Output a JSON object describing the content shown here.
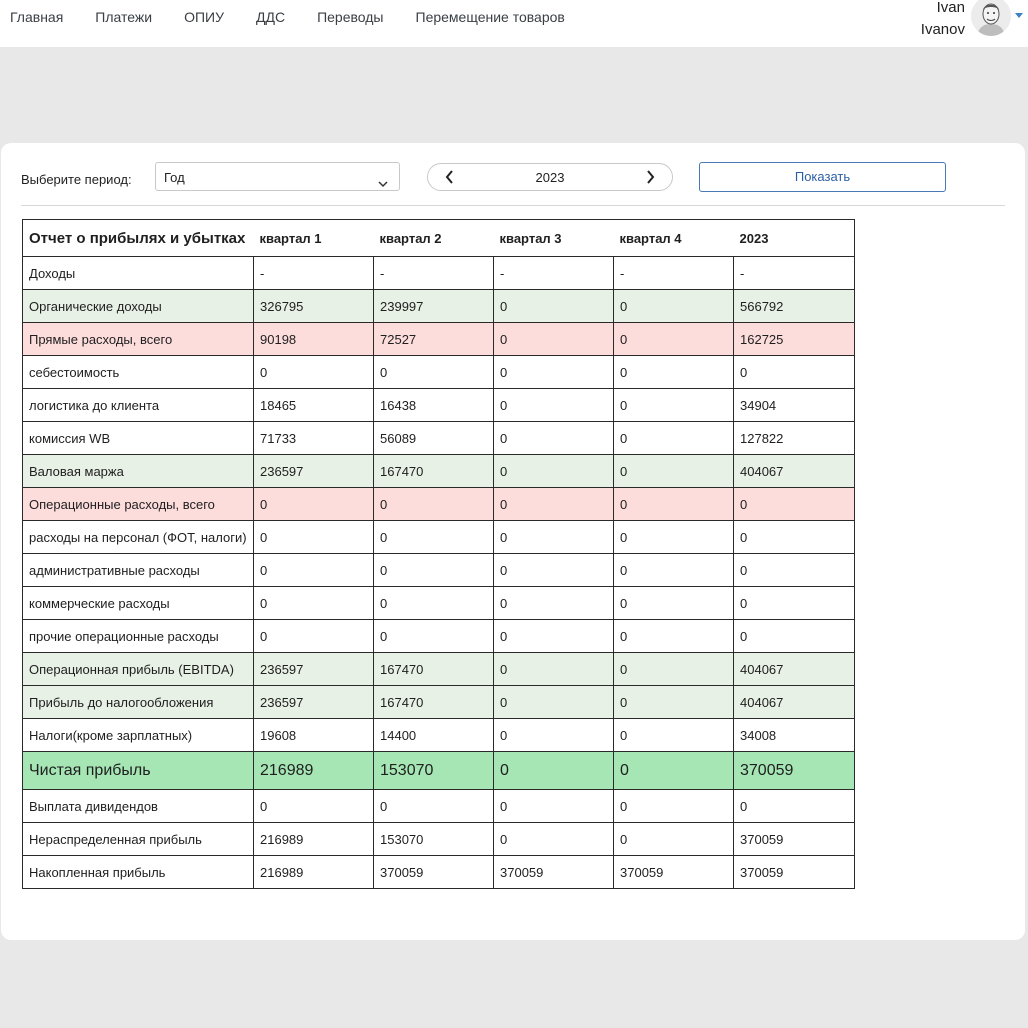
{
  "nav": {
    "items": [
      "Главная",
      "Платежи",
      "ОПИУ",
      "ДДС",
      "Переводы",
      "Перемещение товаров"
    ]
  },
  "user": {
    "first_name": "Ivan",
    "last_name": "Ivanov"
  },
  "filters": {
    "period_label": "Выберите период:",
    "period_value": "Год",
    "year": "2023",
    "show_button": "Показать"
  },
  "report": {
    "title": "Отчет о прибылях и убытках",
    "columns": [
      "квартал 1",
      "квартал 2",
      "квартал 3",
      "квартал 4",
      "2023"
    ],
    "rows": [
      {
        "label": "Доходы",
        "values": [
          "-",
          "-",
          "-",
          "-",
          "-"
        ],
        "style": "plain"
      },
      {
        "label": "Органические доходы",
        "values": [
          "326795",
          "239997",
          "0",
          "0",
          "566792"
        ],
        "style": "green"
      },
      {
        "label": "Прямые расходы, всего",
        "values": [
          "90198",
          "72527",
          "0",
          "0",
          "162725"
        ],
        "style": "red"
      },
      {
        "label": "себестоимость",
        "values": [
          "0",
          "0",
          "0",
          "0",
          "0"
        ],
        "style": "plain"
      },
      {
        "label": "логистика до клиента",
        "values": [
          "18465",
          "16438",
          "0",
          "0",
          "34904"
        ],
        "style": "plain"
      },
      {
        "label": "комиссия WB",
        "values": [
          "71733",
          "56089",
          "0",
          "0",
          "127822"
        ],
        "style": "plain"
      },
      {
        "label": "Валовая маржа",
        "values": [
          "236597",
          "167470",
          "0",
          "0",
          "404067"
        ],
        "style": "green"
      },
      {
        "label": "Операционные расходы, всего",
        "values": [
          "0",
          "0",
          "0",
          "0",
          "0"
        ],
        "style": "red"
      },
      {
        "label": "расходы на персонал (ФОТ, налоги)",
        "values": [
          "0",
          "0",
          "0",
          "0",
          "0"
        ],
        "style": "plain"
      },
      {
        "label": "административные расходы",
        "values": [
          "0",
          "0",
          "0",
          "0",
          "0"
        ],
        "style": "plain"
      },
      {
        "label": "коммерческие расходы",
        "values": [
          "0",
          "0",
          "0",
          "0",
          "0"
        ],
        "style": "plain"
      },
      {
        "label": "прочие операционные расходы",
        "values": [
          "0",
          "0",
          "0",
          "0",
          "0"
        ],
        "style": "plain"
      },
      {
        "label": "Операционная прибыль (EBITDA)",
        "values": [
          "236597",
          "167470",
          "0",
          "0",
          "404067"
        ],
        "style": "green"
      },
      {
        "label": "Прибыль до налогообложения",
        "values": [
          "236597",
          "167470",
          "0",
          "0",
          "404067"
        ],
        "style": "green"
      },
      {
        "label": "Налоги(кроме зарплатных)",
        "values": [
          "19608",
          "14400",
          "0",
          "0",
          "34008"
        ],
        "style": "plain"
      },
      {
        "label": "Чистая прибыль",
        "values": [
          "216989",
          "153070",
          "0",
          "0",
          "370059"
        ],
        "style": "net"
      },
      {
        "label": "Выплата дивидендов",
        "values": [
          "0",
          "0",
          "0",
          "0",
          "0"
        ],
        "style": "plain"
      },
      {
        "label": "Нераспределенная прибыль",
        "values": [
          "216989",
          "153070",
          "0",
          "0",
          "370059"
        ],
        "style": "plain"
      },
      {
        "label": "Накопленная прибыль",
        "values": [
          "216989",
          "370059",
          "370059",
          "370059",
          "370059"
        ],
        "style": "plain"
      }
    ]
  },
  "colors": {
    "green_row": "#e8f1e5",
    "red_row": "#fddcdc",
    "net_row": "#a5e6b4",
    "accent": "#2d5fa4"
  },
  "icons": [
    "chevron-down-icon",
    "chevron-left-icon",
    "chevron-right-icon",
    "avatar-icon",
    "caret-down-icon"
  ]
}
